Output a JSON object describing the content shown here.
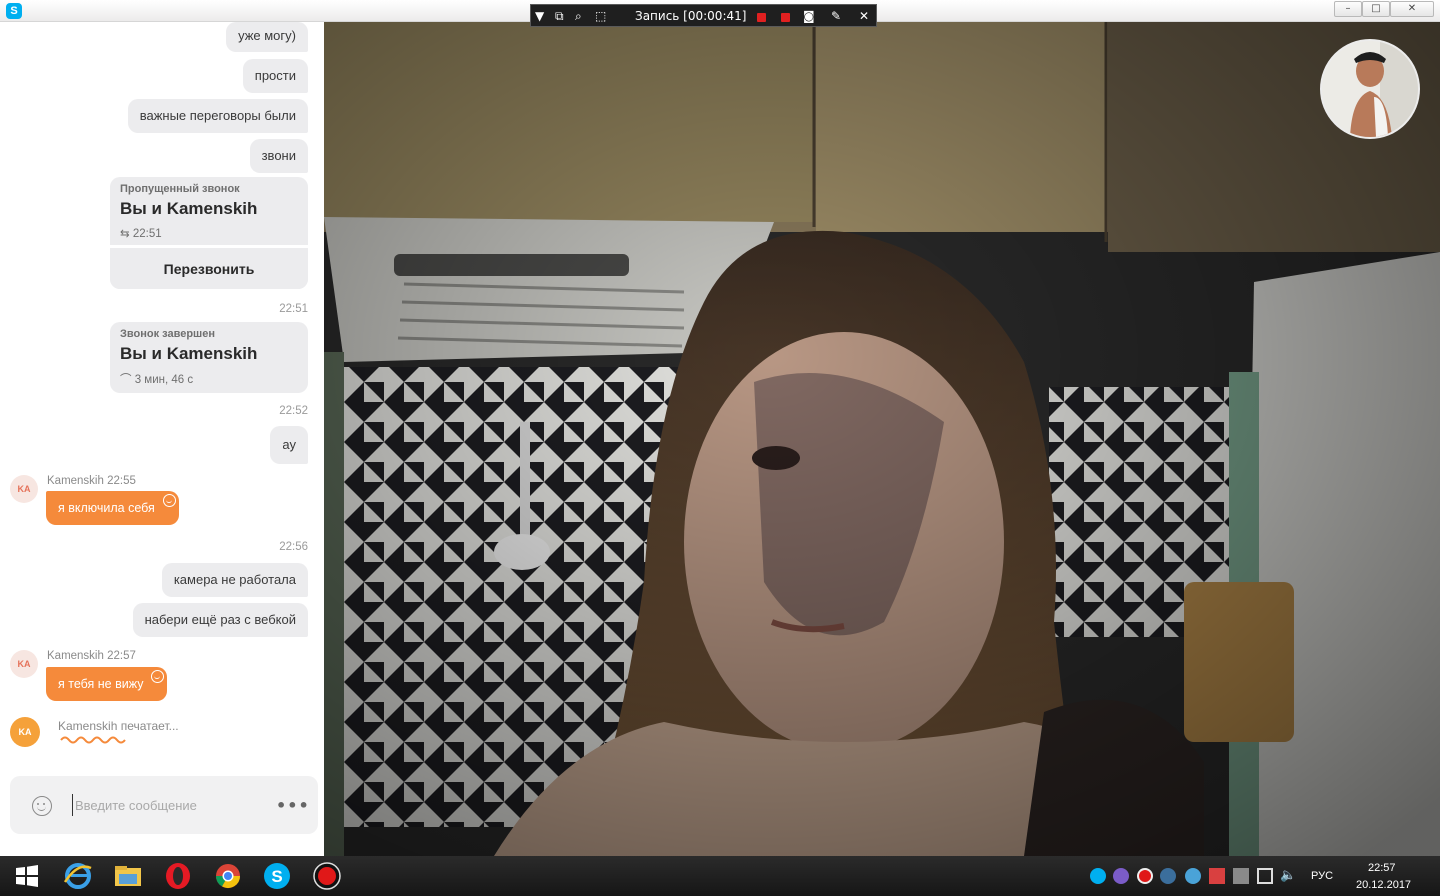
{
  "recorder": {
    "status": "Запись [00:00:41]"
  },
  "window": {
    "app_icon_letter": "S",
    "minimize": "–",
    "maximize": "□",
    "close": "✕"
  },
  "chat": {
    "outgoing_top": [
      {
        "text": "уже могу)"
      },
      {
        "text": "прости"
      },
      {
        "text": "важные переговоры были"
      },
      {
        "text": "звони"
      }
    ],
    "missed_call": {
      "title": "Пропущенный звонок",
      "main": "Вы и Kamenskih",
      "time": "22:51",
      "action": "Перезвонить"
    },
    "ts1": "22:51",
    "ended_call": {
      "title": "Звонок завершен",
      "main": "Вы и Kamenskih",
      "duration": "3 мин, 46 с"
    },
    "ts2": "22:52",
    "out_ay": "ау",
    "in1": {
      "avatar": "KA",
      "sender": "Kamenskih 22:55",
      "text": "я включила себя"
    },
    "ts3": "22:56",
    "out_mid": [
      {
        "text": "камера не работала"
      },
      {
        "text": "набери ещё раз с вебкой"
      }
    ],
    "in2": {
      "avatar": "KA",
      "sender": "Kamenskih 22:57",
      "text": "я тебя не вижу"
    },
    "typing": {
      "avatar": "KA",
      "text": "Kamenskih печатает..."
    },
    "composer": {
      "placeholder": "Введите сообщение",
      "more": "•••"
    }
  },
  "taskbar": {
    "language": "РУС",
    "time": "22:57",
    "date": "20.12.2017"
  },
  "colors": {
    "accent_orange": "#f58a3b",
    "skype_blue": "#00aff0"
  }
}
